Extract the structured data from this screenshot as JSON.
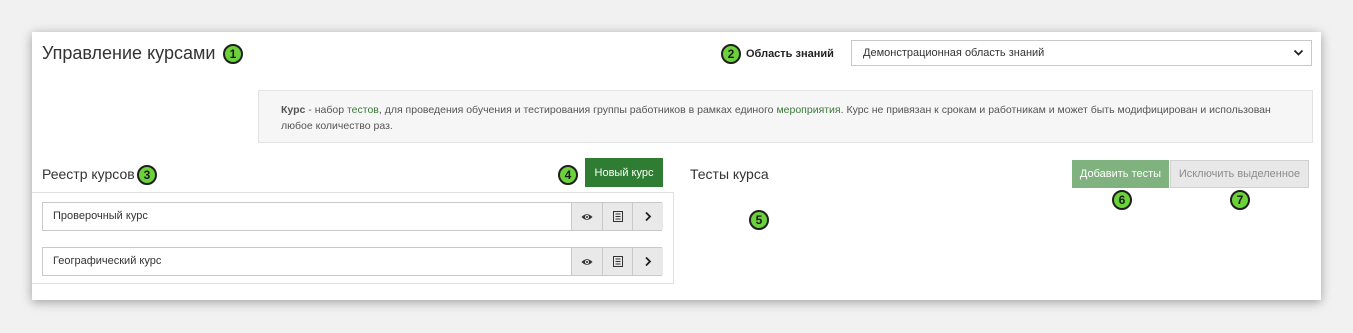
{
  "header": {
    "title": "Управление курсами",
    "badge1": "1",
    "area_label": "Область знаний",
    "badge2": "2",
    "area_value": "Демонстрационная область знаний"
  },
  "info": {
    "term": "Курс",
    "part1": " - набор ",
    "link_tests": "тестов",
    "part2": ", для проведения обучения и тестирования группы работников в рамках единого ",
    "link_event": "мероприятия",
    "part3": ". Курс не привязан к срокам и работникам и может быть модифицирован и использован любое количество раз."
  },
  "registry": {
    "title": "Реестр курсов",
    "badge3": "3",
    "new_button": "Новый курс",
    "badge4": "4",
    "courses": [
      {
        "name": "Проверочный курс"
      },
      {
        "name": "Географический курс"
      }
    ]
  },
  "tests": {
    "title": "Тесты курса",
    "badge5": "5",
    "add_button": "Добавить тесты",
    "badge6": "6",
    "exclude_button": "Исключить выделенное",
    "badge7": "7"
  },
  "icons": {
    "view": "eye-icon",
    "details": "list-icon",
    "open": "chevron-right-icon",
    "dropdown": "chevron-down-icon"
  },
  "colors": {
    "accent": "#2e7d32",
    "accent_light": "#7fb27f",
    "badge": "#6cd23a"
  }
}
